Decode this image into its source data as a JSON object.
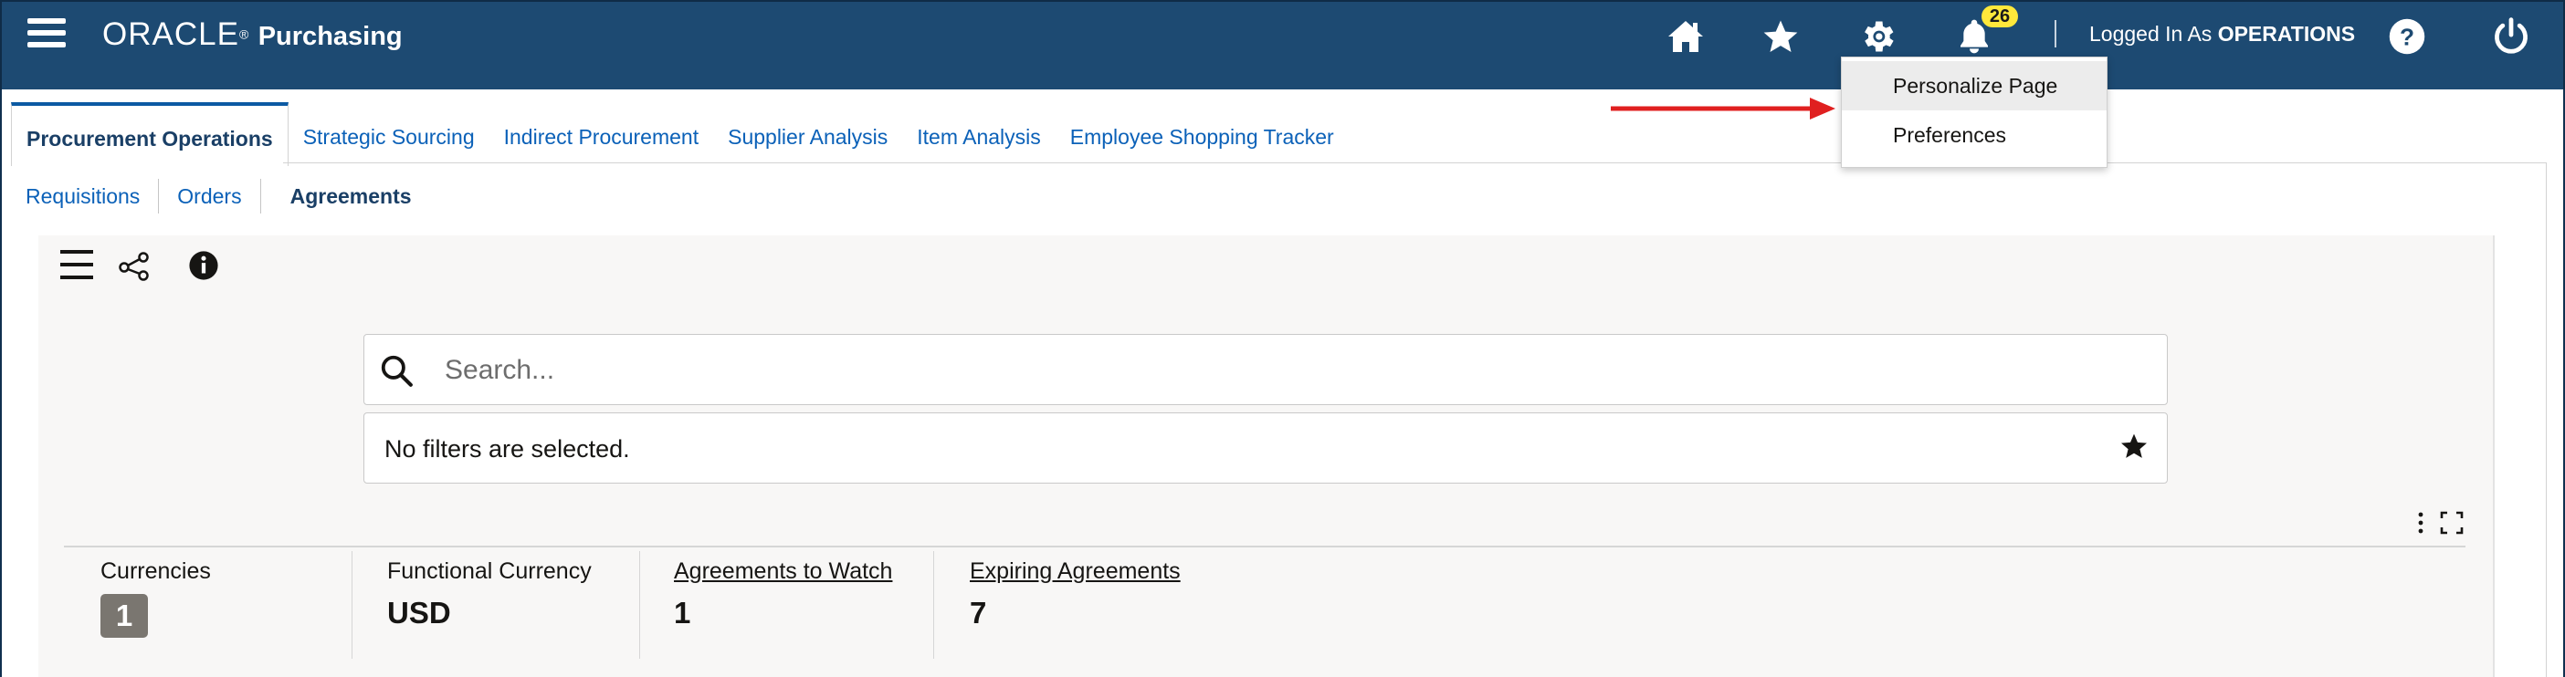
{
  "header": {
    "brand": "ORACLE",
    "app_name": "Purchasing",
    "notification_count": "26",
    "logged_in_prefix": "Logged In As",
    "logged_in_user": "OPERATIONS",
    "icons": [
      "menu-icon",
      "home-icon",
      "star-icon",
      "gear-icon",
      "bell-icon",
      "help-icon",
      "power-icon"
    ]
  },
  "settings_menu": {
    "items": [
      "Personalize Page",
      "Preferences"
    ],
    "highlighted": "Personalize Page"
  },
  "tabs": [
    {
      "label": "Procurement Operations",
      "active": true
    },
    {
      "label": "Strategic Sourcing"
    },
    {
      "label": "Indirect Procurement"
    },
    {
      "label": "Supplier Analysis"
    },
    {
      "label": "Item Analysis"
    },
    {
      "label": "Employee Shopping Tracker"
    }
  ],
  "subtabs": [
    {
      "label": "Requisitions"
    },
    {
      "label": "Orders"
    },
    {
      "label": "Agreements",
      "active": true
    }
  ],
  "search": {
    "placeholder": "Search...",
    "filters_text": "No filters are selected."
  },
  "metrics": [
    {
      "label": "Currencies",
      "value": "1",
      "link": false
    },
    {
      "label": "Functional Currency",
      "value": "USD",
      "link": false
    },
    {
      "label": "Agreements to Watch",
      "value": "1",
      "link": true
    },
    {
      "label": "Expiring Agreements",
      "value": "7",
      "link": true
    }
  ],
  "colors": {
    "header_bg": "#1d4a72",
    "link": "#0b61b8",
    "badge": "#ffe83b",
    "annotation_arrow": "#e02020"
  }
}
